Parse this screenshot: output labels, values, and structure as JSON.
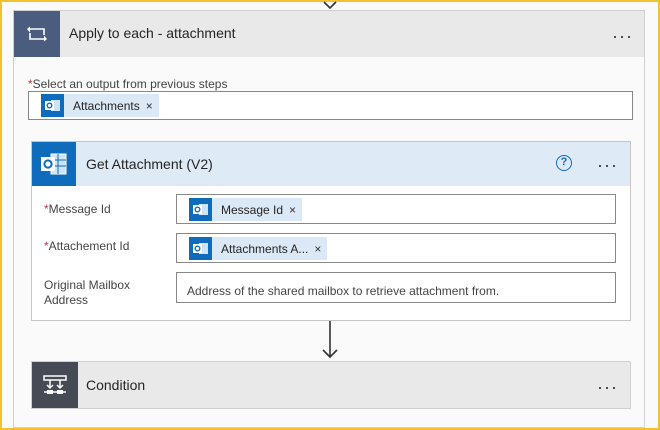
{
  "loop": {
    "title": "Apply to each - attachment",
    "select_label_required": "*",
    "select_label": "Select an output from previous steps",
    "select_token": "Attachments",
    "menu": "···"
  },
  "action": {
    "title": "Get Attachment (V2)",
    "help": "?",
    "menu": "···",
    "fields": {
      "message_id": {
        "required": "*",
        "label": "Message Id",
        "token": "Message Id"
      },
      "attachment_id": {
        "required": "*",
        "label": "Attachement Id",
        "token": "Attachments A..."
      },
      "mailbox": {
        "label_line1": "Original Mailbox",
        "label_line2": "Address",
        "placeholder": "Address of the shared mailbox to retrieve attachment from."
      }
    }
  },
  "condition": {
    "title": "Condition",
    "menu": "···"
  },
  "token_close": "×",
  "icons": {
    "loop": "loop-icon",
    "outlook": "outlook-icon",
    "condition": "condition-icon",
    "arrow": "arrow-down-icon"
  },
  "colors": {
    "loop_icon_bg": "#4b5d7e",
    "outlook_blue": "#0f6cbd",
    "condition_icon_bg": "#464a55",
    "frame_border": "#f2c230",
    "required": "#c4314b"
  }
}
